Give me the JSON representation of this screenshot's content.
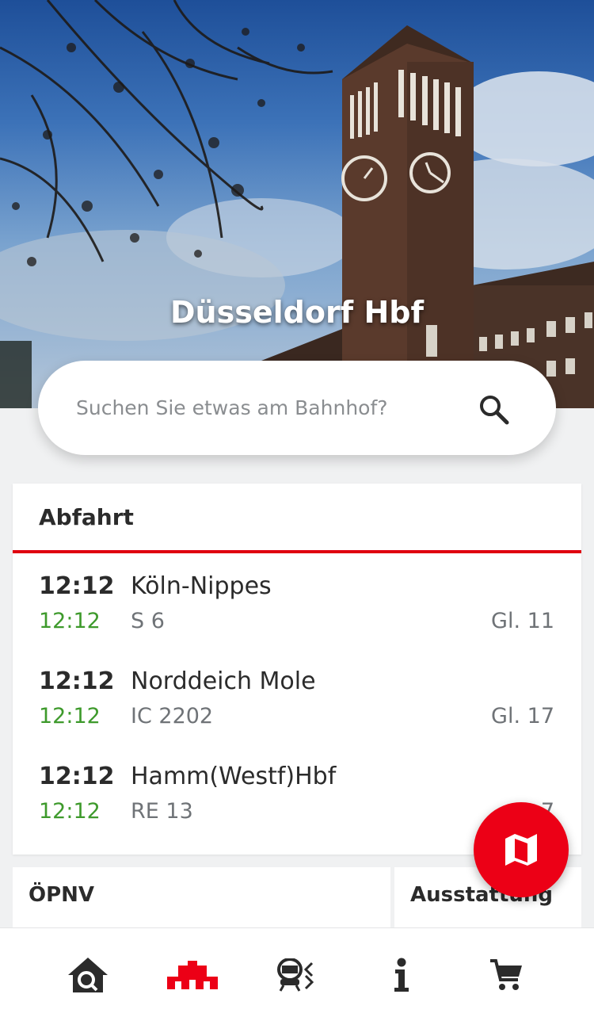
{
  "station": {
    "title": "Düsseldorf Hbf"
  },
  "search": {
    "placeholder": "Suchen Sie etwas am Bahnhof?"
  },
  "departures": {
    "title": "Abfahrt",
    "rows": [
      {
        "time": "12:12",
        "realtime": "12:12",
        "destination": "Köln-Nippes",
        "line": "S 6",
        "track": "Gl. 11"
      },
      {
        "time": "12:12",
        "realtime": "12:12",
        "destination": "Norddeich Mole",
        "line": "IC 2202",
        "track": "Gl. 17"
      },
      {
        "time": "12:12",
        "realtime": "12:12",
        "destination": "Hamm(Westf)Hbf",
        "line": "RE 13",
        "track": "7"
      }
    ]
  },
  "tiles": {
    "oepnv": "ÖPNV",
    "ausstattung": "Ausstattung"
  },
  "nav": {
    "items": [
      {
        "icon": "home-search-icon"
      },
      {
        "icon": "station-icon",
        "active": true
      },
      {
        "icon": "timetable-icon"
      },
      {
        "icon": "info-icon"
      },
      {
        "icon": "cart-icon"
      }
    ]
  },
  "colors": {
    "accent": "#ec0016",
    "realtime": "#3e9a2c",
    "text": "#2b2b2b",
    "muted": "#6f7377"
  }
}
